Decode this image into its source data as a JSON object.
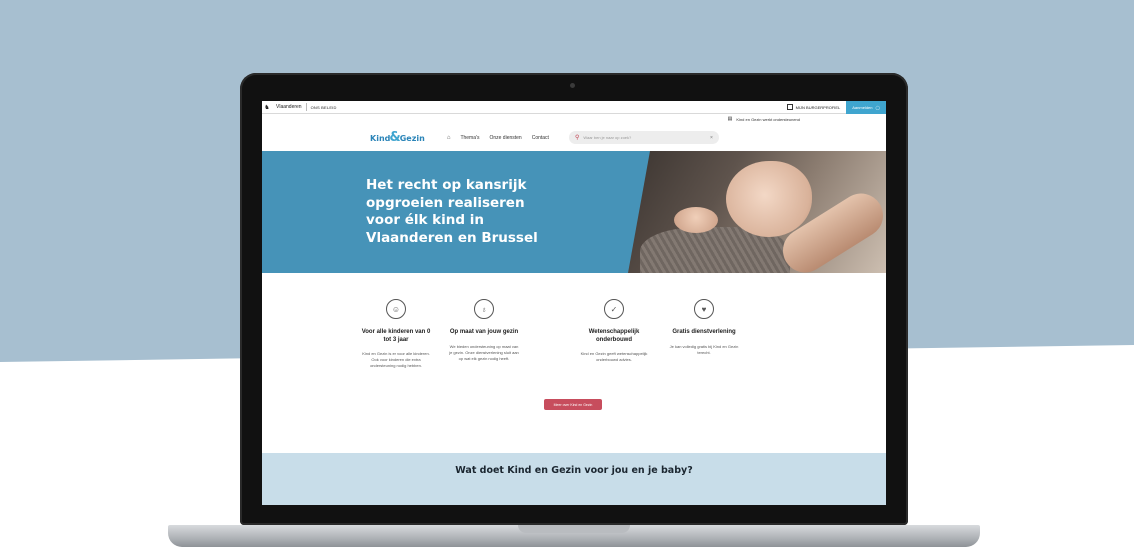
{
  "colors": {
    "background_band": "#a7bfd0",
    "brand_blue": "#2a84b8",
    "hero_blue": "#4693b8",
    "cta_red": "#c74d5d",
    "login_blue": "#3fa5cf"
  },
  "flemish_bar": {
    "region": "Vlaanderen",
    "tagline": "ONS BELEID",
    "profile_label": "MIJN BURGERPROFIEL",
    "login_label": "Aanmelden"
  },
  "util_bar": {
    "link": "Kind en Gezin werkt ondersteunend"
  },
  "header": {
    "brand_left": "Kind",
    "brand_amp": "&",
    "brand_right": "Gezin",
    "nav": [
      "Thema's",
      "Onze diensten",
      "Contact"
    ],
    "search_placeholder": "Waar ben je naar op zoek?"
  },
  "hero": {
    "title": "Het recht op kansrijk opgroeien realiseren voor élk kind in Vlaanderen en Brussel"
  },
  "features": [
    {
      "icon": "baby-icon",
      "title": "Voor alle kinderen van 0 tot 3 jaar",
      "text": "Kind en Gezin is er voor alle kinderen. Ook voor kinderen die extra ondersteuning nodig hebben."
    },
    {
      "icon": "pacifier-icon",
      "title": "Op maat van jouw gezin",
      "text": "We bieden ondersteuning op maat van je gezin. Onze dienstverlening sluit aan op wat elk gezin nodig heeft."
    },
    {
      "icon": "shield-check-icon",
      "title": "Wetenschappelijk onderbouwd",
      "text": "Kind en Gezin geeft wetenschappelijk onderbouwd advies."
    },
    {
      "icon": "heart-hands-icon",
      "title": "Gratis dienstverlening",
      "text": "Je kan volledig gratis bij Kind en Gezin terecht."
    }
  ],
  "cta_label": "Meer over Kind en Gezin",
  "section_title": "Wat doet Kind en Gezin voor jou en je baby?"
}
